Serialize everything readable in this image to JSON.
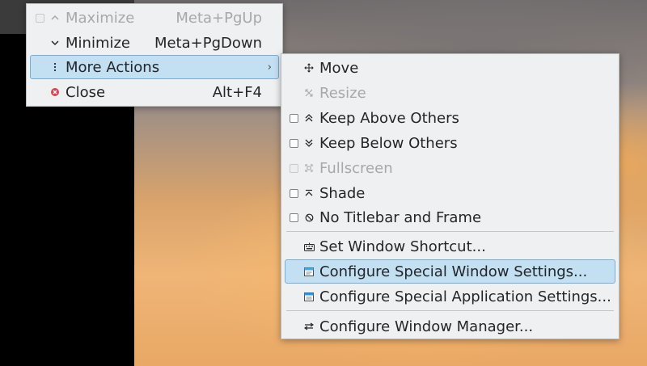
{
  "main_menu": {
    "items": [
      {
        "label": "Maximize",
        "shortcut": "Meta+PgUp",
        "icon": "maximize-chevron-up-icon",
        "disabled": true,
        "checkbox": true
      },
      {
        "label": "Minimize",
        "shortcut": "Meta+PgDown",
        "icon": "minimize-chevron-down-icon"
      },
      {
        "label": "More Actions",
        "submenu_arrow": "›",
        "icon": "more-actions-dots-icon",
        "highlighted": true
      },
      {
        "label": "Close",
        "shortcut": "Alt+F4",
        "icon": "close-circle-icon",
        "icon_color": "#da4453"
      }
    ]
  },
  "more_actions_menu": {
    "items": [
      {
        "label": "Move",
        "icon": "move-arrows-icon"
      },
      {
        "label": "Resize",
        "icon": "resize-icon",
        "disabled": true
      },
      {
        "label": "Keep Above Others",
        "icon": "double-chevron-up-icon",
        "checkbox": true
      },
      {
        "label": "Keep Below Others",
        "icon": "double-chevron-down-icon",
        "checkbox": true
      },
      {
        "label": "Fullscreen",
        "icon": "fullscreen-icon",
        "checkbox": true,
        "disabled": true
      },
      {
        "label": "Shade",
        "icon": "shade-icon",
        "checkbox": true
      },
      {
        "label": "No Titlebar and Frame",
        "icon": "no-frame-icon",
        "checkbox": true
      },
      {
        "label": "Set Window Shortcut...",
        "icon": "keyboard-icon"
      },
      {
        "label": "Configure Special Window Settings...",
        "icon": "window-settings-icon",
        "highlighted": true
      },
      {
        "label": "Configure Special Application Settings...",
        "icon": "application-settings-icon"
      },
      {
        "label": "Configure Window Manager...",
        "icon": "window-manager-icon"
      }
    ]
  },
  "colors": {
    "menu_bg": "#eff0f1",
    "highlight_bg": "#c3dff2",
    "highlight_border": "#74aee0",
    "close_icon": "#da4453"
  }
}
